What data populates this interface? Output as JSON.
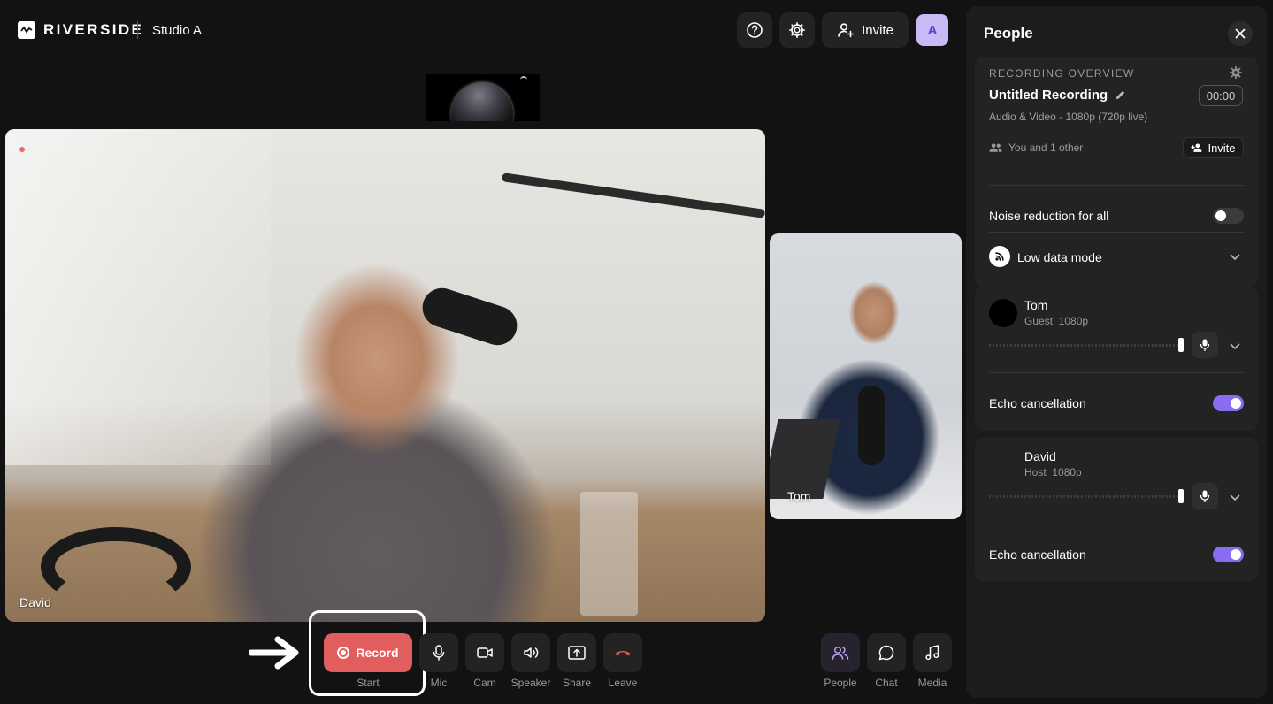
{
  "header": {
    "logo_text": "RIVERSIDE",
    "studio_name": "Studio A",
    "invite_label": "Invite",
    "avatar_initial": "A"
  },
  "stage": {
    "main_participant": "David",
    "guest_participant": "Tom"
  },
  "controls": {
    "record_label": "Record",
    "record_caption": "Start",
    "items": [
      {
        "label": "Mic",
        "icon": "mic-icon"
      },
      {
        "label": "Cam",
        "icon": "camera-icon"
      },
      {
        "label": "Speaker",
        "icon": "speaker-icon"
      },
      {
        "label": "Share",
        "icon": "share-screen-icon"
      },
      {
        "label": "Leave",
        "icon": "leave-phone-icon"
      }
    ],
    "right_items": [
      {
        "label": "People",
        "icon": "people-icon"
      },
      {
        "label": "Chat",
        "icon": "chat-icon"
      },
      {
        "label": "Media",
        "icon": "music-icon"
      }
    ]
  },
  "panel": {
    "title": "People",
    "overview": {
      "heading": "RECORDING OVERVIEW",
      "recording_title": "Untitled Recording",
      "timer": "00:00",
      "subtitle": "Audio & Video - 1080p (720p live)",
      "people_count": "You and 1 other",
      "invite_label": "Invite",
      "noise_reduction_label": "Noise reduction for all",
      "noise_reduction_on": false,
      "low_data_label": "Low data mode"
    },
    "participants": [
      {
        "name": "Tom",
        "role": "Guest",
        "quality": "1080p",
        "echo_label": "Echo cancellation",
        "echo_on": true,
        "volume": 1.0
      },
      {
        "name": "David",
        "role": "Host",
        "quality": "1080p",
        "echo_label": "Echo cancellation",
        "echo_on": true,
        "volume": 1.0
      }
    ]
  },
  "colors": {
    "accent": "#8a6cf0",
    "record": "#e25d5d",
    "leave": "#e25d5d",
    "background": "#121212"
  }
}
